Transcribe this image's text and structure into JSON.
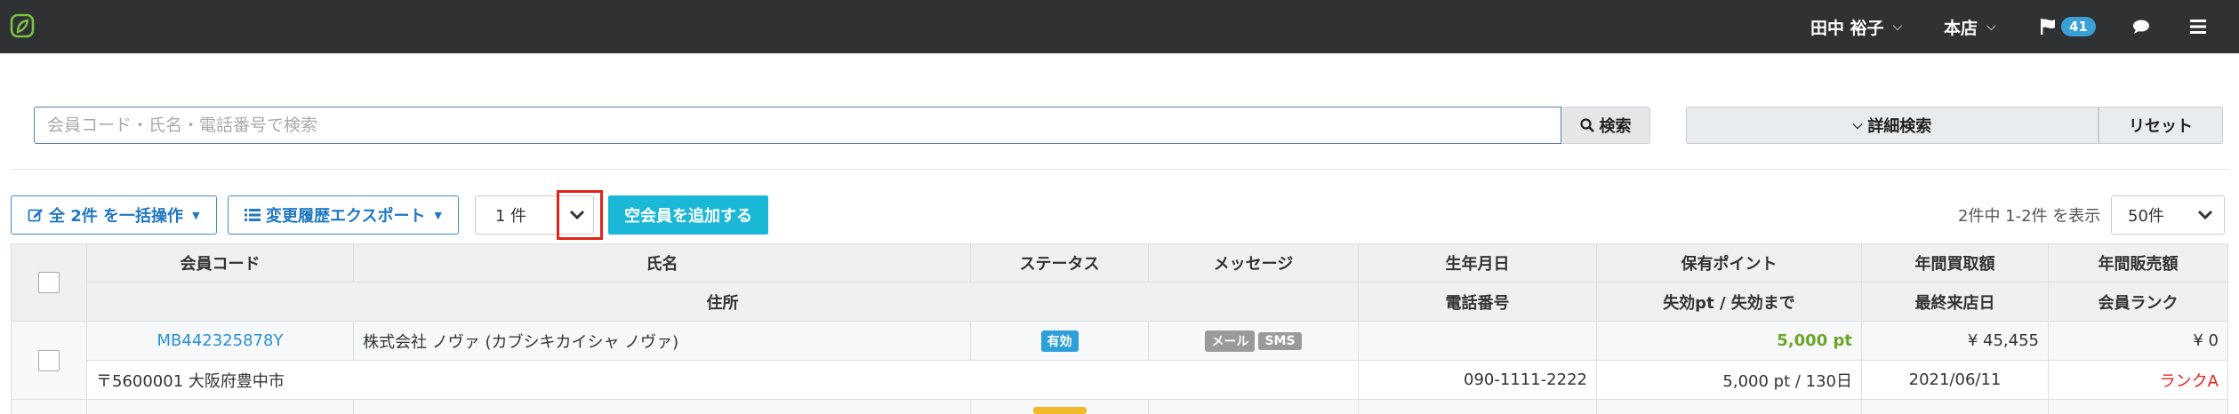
{
  "topbar": {
    "user_name": "田中 裕子",
    "store": "本店",
    "notification_count": "41"
  },
  "search": {
    "placeholder": "会員コード・氏名・電話番号で検索",
    "search_label": "検索",
    "advanced_label": "詳細検索",
    "reset_label": "リセット"
  },
  "actions": {
    "bulk_label": "全 2件 を一括操作",
    "export_label": "変更履歴エクスポート",
    "count_value": "1 件",
    "add_label": "空会員を追加する",
    "range_text": "2件中 1-2件 を表示",
    "per_page": "50件"
  },
  "table": {
    "headers_row1": [
      "会員コード",
      "氏名",
      "ステータス",
      "メッセージ",
      "生年月日",
      "保有ポイント",
      "年間買取額",
      "年間販売額"
    ],
    "headers_row2": [
      "住所",
      "電話番号",
      "失効pt / 失効まで",
      "最終来店日",
      "会員ランク"
    ],
    "rows": [
      {
        "code": "MB442325878Y",
        "name": "株式会社 ノヴァ (カブシキカイシャ ノヴァ)",
        "status": "有効",
        "msg_mail": "メール",
        "msg_sms": "SMS",
        "birthday": "",
        "points": "5,000 pt",
        "annual_buy": "¥ 45,455",
        "annual_sell": "¥ 0",
        "address": "〒5600001 大阪府豊中市",
        "phone": "090-1111-2222",
        "expire": "5,000 pt / 130日",
        "last_visit": "2021/06/11",
        "rank": "ランクA"
      }
    ]
  },
  "colors": {
    "topbar": "#2f3133",
    "accent": "#1ab8d6",
    "link": "#2a8fd6",
    "points_green": "#6aa52a",
    "rank_red": "#e2231a"
  }
}
